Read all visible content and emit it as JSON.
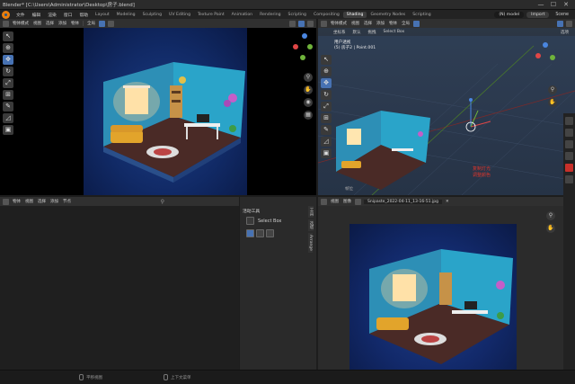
{
  "window": {
    "title": "Blender* [C:\\Users\\Administrator\\Desktop\\房子.blend]",
    "controls": [
      "—",
      "☐",
      "✕"
    ]
  },
  "menubar": {
    "menus": [
      "文件",
      "编辑",
      "渲染",
      "窗口",
      "帮助"
    ],
    "workspaces": [
      "Layout",
      "Modeling",
      "Sculpting",
      "UV Editing",
      "Texture Paint",
      "Animation",
      "Rendering",
      "Scripting",
      "Compositing",
      "Shading",
      "Geometry Nodes",
      "Scripting"
    ],
    "active_workspace_index": 9,
    "right": {
      "model": "(N) model",
      "scene_label": "Scene",
      "import_label": "Import"
    }
  },
  "viewport_left": {
    "header": {
      "mode": "物体模式",
      "view": "视图",
      "select": "选择",
      "add": "添加",
      "object": "物体",
      "orientation": "全局"
    },
    "gizmo_axes": {
      "x_color": "#e04646",
      "y_color": "#6fb33b",
      "z_color": "#4a86e0"
    }
  },
  "viewport_right": {
    "header": {
      "mode": "物体模式",
      "view": "视图",
      "select": "选择",
      "add": "添加",
      "object": "物体",
      "orientation": "全局",
      "options": "选项"
    },
    "subheader": {
      "orientation_label": "坐标系",
      "default": "默认",
      "drag": "拖拽",
      "select_box": "Select Box"
    },
    "overlay": {
      "line1": "用户透视",
      "line2": "(5) 房子2 | Point.001"
    },
    "annotation": [
      "复制灯光",
      "调整颜色"
    ],
    "status_small": "帧位"
  },
  "timeline_area": {
    "header": {
      "mode": "物体",
      "view": "视图",
      "select": "选择",
      "add": "添加",
      "node": "节点"
    }
  },
  "sidebar": {
    "panel_title": "活动工具",
    "tool_label": "Select Box",
    "tabs": [
      "工具",
      "选项",
      "Arrange"
    ]
  },
  "image_editor": {
    "header": {
      "view": "视图",
      "image": "图像",
      "filename": "Snipaste_2022-04-11_13-16-51.jpg"
    }
  },
  "statusbar": {
    "items": [
      "平移视图",
      "上下文菜单"
    ]
  }
}
